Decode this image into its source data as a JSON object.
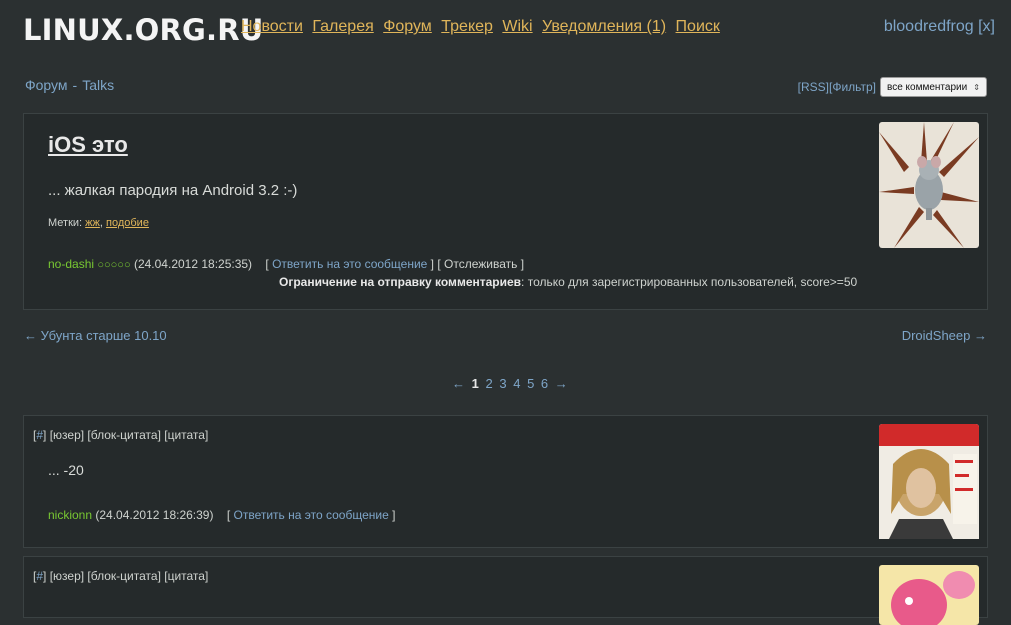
{
  "site": {
    "logo": "LINUX.ORG.RU"
  },
  "nav": {
    "items": [
      "Новости",
      "Галерея",
      "Форум",
      "Трекер",
      "Wiki",
      "Уведомления (1)",
      "Поиск"
    ]
  },
  "user": {
    "name": "bloodredfrog",
    "logout": "[x]"
  },
  "breadcrumb": {
    "root": "Форум",
    "sep": "-",
    "section": "Talks"
  },
  "tools": {
    "rss": "[RSS]",
    "filter": "[Фильтр]",
    "select_value": "все комментарии"
  },
  "topic": {
    "title": "iOS это",
    "body": "... жалкая пародия на Android 3.2 :-)",
    "tags_label": "Метки:",
    "tags": [
      "жж",
      "подобие"
    ],
    "author": "no-dashi",
    "stars": "○○○○○",
    "date": "(24.04.2012 18:25:35)",
    "reply": "Ответить на это сообщение",
    "track": "Отслеживать",
    "restrict_label": "Ограничение на отправку комментариев",
    "restrict_text": ": только для зарегистрированных пользователей, score>=50"
  },
  "prevnext": {
    "prev": "←  Убунта старше 10.10",
    "next": "DroidSheep  →"
  },
  "pager": {
    "prev": "←",
    "pages": [
      "1",
      "2",
      "3",
      "4",
      "5",
      "6"
    ],
    "next": "→"
  },
  "comments": [
    {
      "actions": {
        "hash": "#",
        "user": "юзер",
        "block_quote": "блок-цитата",
        "quote": "цитата"
      },
      "body": "... -20",
      "author": "nickionn",
      "date": "(24.04.2012 18:26:39)",
      "reply": "Ответить на это сообщение"
    },
    {
      "actions": {
        "hash": "#",
        "user": "юзер",
        "block_quote": "блок-цитата",
        "quote": "цитата"
      }
    }
  ],
  "colors": {
    "bg": "#2b3031",
    "panel": "#252a2b",
    "link": "#7ea5c8",
    "nav": "#e0b55a",
    "nick": "#78c832"
  }
}
